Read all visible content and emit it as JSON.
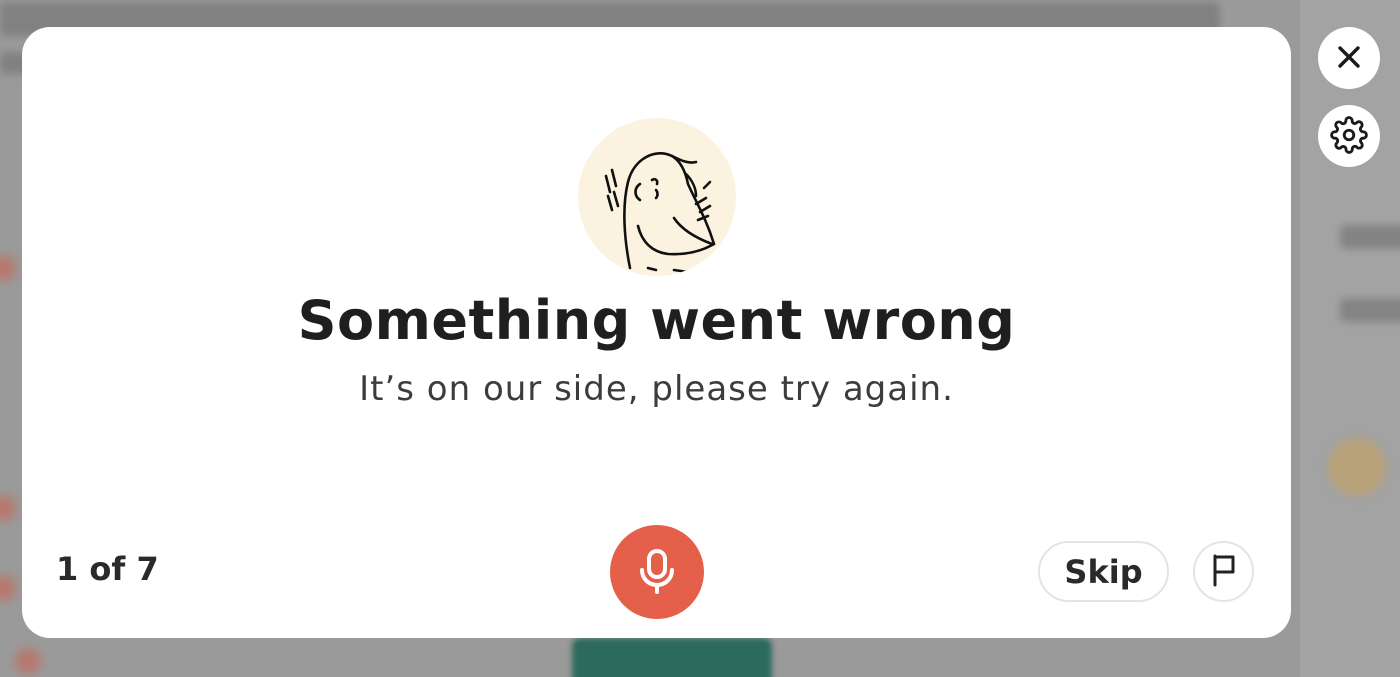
{
  "dialog": {
    "title": "Something went wrong",
    "message": "It’s on our side, please try again.",
    "progress": "1 of 7",
    "skip_label": "Skip"
  },
  "icons": {
    "close": "close-icon",
    "settings": "gear-icon",
    "microphone": "microphone-icon",
    "flag": "flag-icon",
    "illustration": "confused-bird-illustration"
  },
  "colors": {
    "mic_button": "#e4604a",
    "illustration_bg": "#fbf3e0",
    "title_text": "#1f1f1f"
  }
}
